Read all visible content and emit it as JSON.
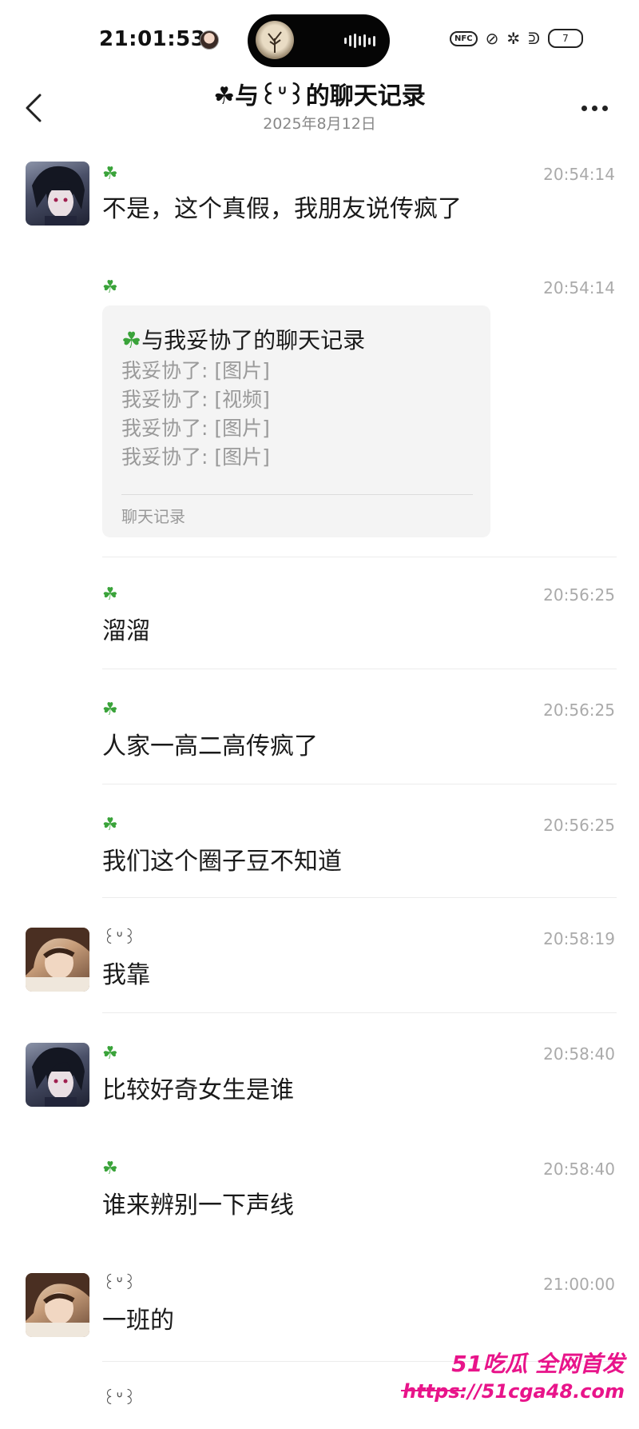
{
  "status_bar": {
    "time": "21:01:53",
    "nfc": "NFC",
    "battery": "7"
  },
  "header": {
    "title": "☘与꒰ᐡ꒱的聊天记录",
    "subtitle": "2025年8月12日"
  },
  "messages": [
    {
      "sender": "☘",
      "time": "20:54:14",
      "text": "不是，这个真假，我朋友说传疯了",
      "avatar": "boy"
    },
    {
      "sender": "☘",
      "time": "20:54:14",
      "type": "chat_record_card"
    },
    {
      "sender": "☘",
      "time": "20:56:25",
      "text": "溜溜"
    },
    {
      "sender": "☘",
      "time": "20:56:25",
      "text": "人家一高二高传疯了"
    },
    {
      "sender": "☘",
      "time": "20:56:25",
      "text": "我们这个圈子豆不知道"
    },
    {
      "sender": "꒰ᐡ꒱",
      "time": "20:58:19",
      "text": "我靠",
      "avatar": "girl"
    },
    {
      "sender": "☘",
      "time": "20:58:40",
      "text": "比较好奇女生是谁",
      "avatar": "boy"
    },
    {
      "sender": "☘",
      "time": "20:58:40",
      "text": "谁来辨别一下声线"
    },
    {
      "sender": "꒰ᐡ꒱",
      "time": "21:00:00",
      "text": "一班的",
      "avatar": "girl"
    },
    {
      "sender": "꒰ᐡ꒱",
      "time": "",
      "text": ""
    }
  ],
  "chat_record_card": {
    "title_icon": "☘",
    "title": "与我妥协了的聊天记录",
    "lines": [
      "我妥协了: [图片]",
      "我妥协了: [视频]",
      "我妥协了: [图片]",
      "我妥协了: [图片]"
    ],
    "footer": "聊天记录"
  },
  "watermark": {
    "brand": "51吃瓜 全网首发",
    "url": "https://51cga48.com"
  },
  "colors": {
    "clover_green": "#3aa33a",
    "watermark_pink": "#e8148a",
    "timestamp_gray": "#aaaaaa"
  }
}
